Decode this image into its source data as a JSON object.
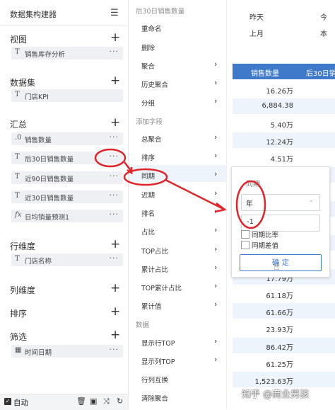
{
  "left_panel": {
    "title": "数据集构建器",
    "sections": {
      "view": {
        "title": "视图",
        "fields": [
          {
            "type_icon": "T",
            "label": "销售库存分析"
          }
        ]
      },
      "dataset": {
        "title": "数据集",
        "fields": [
          {
            "type_icon": "T",
            "label": "门店KPI"
          }
        ]
      },
      "summary": {
        "title": "汇总",
        "fields": [
          {
            "type_icon": ".0",
            "label": "销售数量"
          },
          {
            "type_icon": "T",
            "label": "后30日销售数量"
          },
          {
            "type_icon": "T",
            "label": "近90日销售数量"
          },
          {
            "type_icon": "T",
            "label": "近30日销售数量"
          },
          {
            "type_icon": "fx",
            "label": "日均销量预测1"
          }
        ]
      },
      "row_dim": {
        "title": "行维度",
        "fields": [
          {
            "type_icon": "T",
            "label": "门店名称"
          }
        ]
      },
      "col_dim": {
        "title": "列维度"
      },
      "sort": {
        "title": "排序"
      },
      "filter": {
        "title": "筛选",
        "fields": [
          {
            "type_icon": "calendar-icon",
            "label": "时间日期"
          }
        ]
      }
    },
    "more_label": "···",
    "add_label": "+",
    "footer": {
      "auto_label": "自动"
    }
  },
  "menu": {
    "top_header": "后30日销售数量",
    "items1": [
      "重命名",
      "删除",
      "聚合",
      "历史聚合",
      "分组"
    ],
    "header_add": "添加字段",
    "items2": [
      "总聚合",
      "排序",
      "同期",
      "近期",
      "排名",
      "占比",
      "TOP占比",
      "累计占比",
      "TOP累计占比",
      "累计值"
    ],
    "header_data": "数据",
    "items3": [
      "显示行TOP",
      "显示列TOP",
      "行列互换",
      "清除聚合"
    ]
  },
  "right_panel": {
    "header_rows": [
      {
        "c1": "昨天",
        "c2": "今"
      },
      {
        "c1": "上月",
        "c2": "本"
      }
    ],
    "columns": [
      "销售数量",
      "后30日销"
    ],
    "values": [
      "16.26万",
      "6,884.38",
      "5.40万",
      "12.24万",
      "4.51万",
      "",
      "",
      "",
      "",
      "",
      "",
      "17.79万",
      "61.18万",
      "61.66万",
      "23.93万",
      "86.42万",
      "61.25万",
      "1,523.63万"
    ]
  },
  "popup": {
    "title": "同期",
    "select_value": "年",
    "input_value": "-1",
    "options": [
      "同期比率",
      "同期差值"
    ],
    "ok_label": "确 定"
  },
  "watermark": "知乎 @商业男孩",
  "colors": {
    "accent": "#3f79c9",
    "annotation": "#e0252b"
  }
}
